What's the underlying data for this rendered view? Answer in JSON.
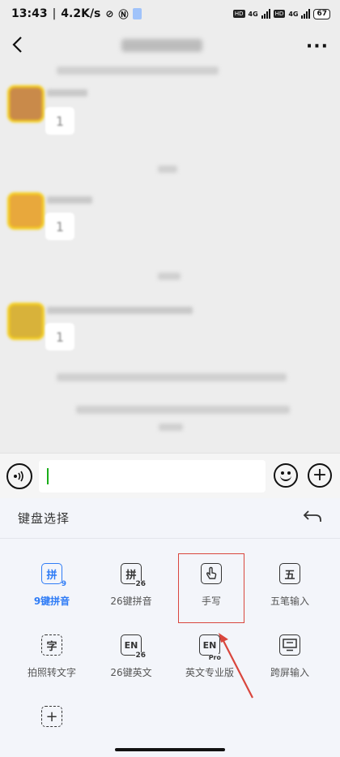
{
  "status_bar": {
    "time": "13:43",
    "speed": "4.2K/s",
    "net1": "4G",
    "net2": "4G",
    "hd": "HD",
    "battery": "67"
  },
  "nav": {
    "back_icon": "chevron-left-icon",
    "more_label": "···"
  },
  "chat": {
    "bubble_text": "1"
  },
  "input_bar": {
    "voice_label": "◉))",
    "plus_label": "+"
  },
  "keyboard_panel": {
    "title": "键盘选择",
    "items": [
      {
        "label": "9键拼音",
        "icon_text": "拼",
        "icon_sub": "9",
        "active": true
      },
      {
        "label": "26键拼音",
        "icon_text": "拼",
        "icon_sub": "26",
        "active": false
      },
      {
        "label": "手写",
        "icon_text": "☝",
        "icon_sub": "",
        "active": false
      },
      {
        "label": "五笔输入",
        "icon_text": "五",
        "icon_sub": "",
        "active": false
      },
      {
        "label": "拍照转文字",
        "icon_text": "字",
        "icon_sub": "",
        "active": false
      },
      {
        "label": "26键英文",
        "icon_text": "EN",
        "icon_sub": "26",
        "active": false
      },
      {
        "label": "英文专业版",
        "icon_text": "EN",
        "icon_sub": "Pro",
        "active": false
      },
      {
        "label": "跨屏输入",
        "icon_text": "▭",
        "icon_sub": "",
        "active": false
      },
      {
        "label": "",
        "icon_text": "+",
        "icon_sub": "",
        "active": false
      }
    ]
  },
  "colors": {
    "accent": "#2f7cf6",
    "highlight": "#d9463d",
    "chat_bg": "#ededed",
    "panel_bg": "#f3f5fa"
  }
}
